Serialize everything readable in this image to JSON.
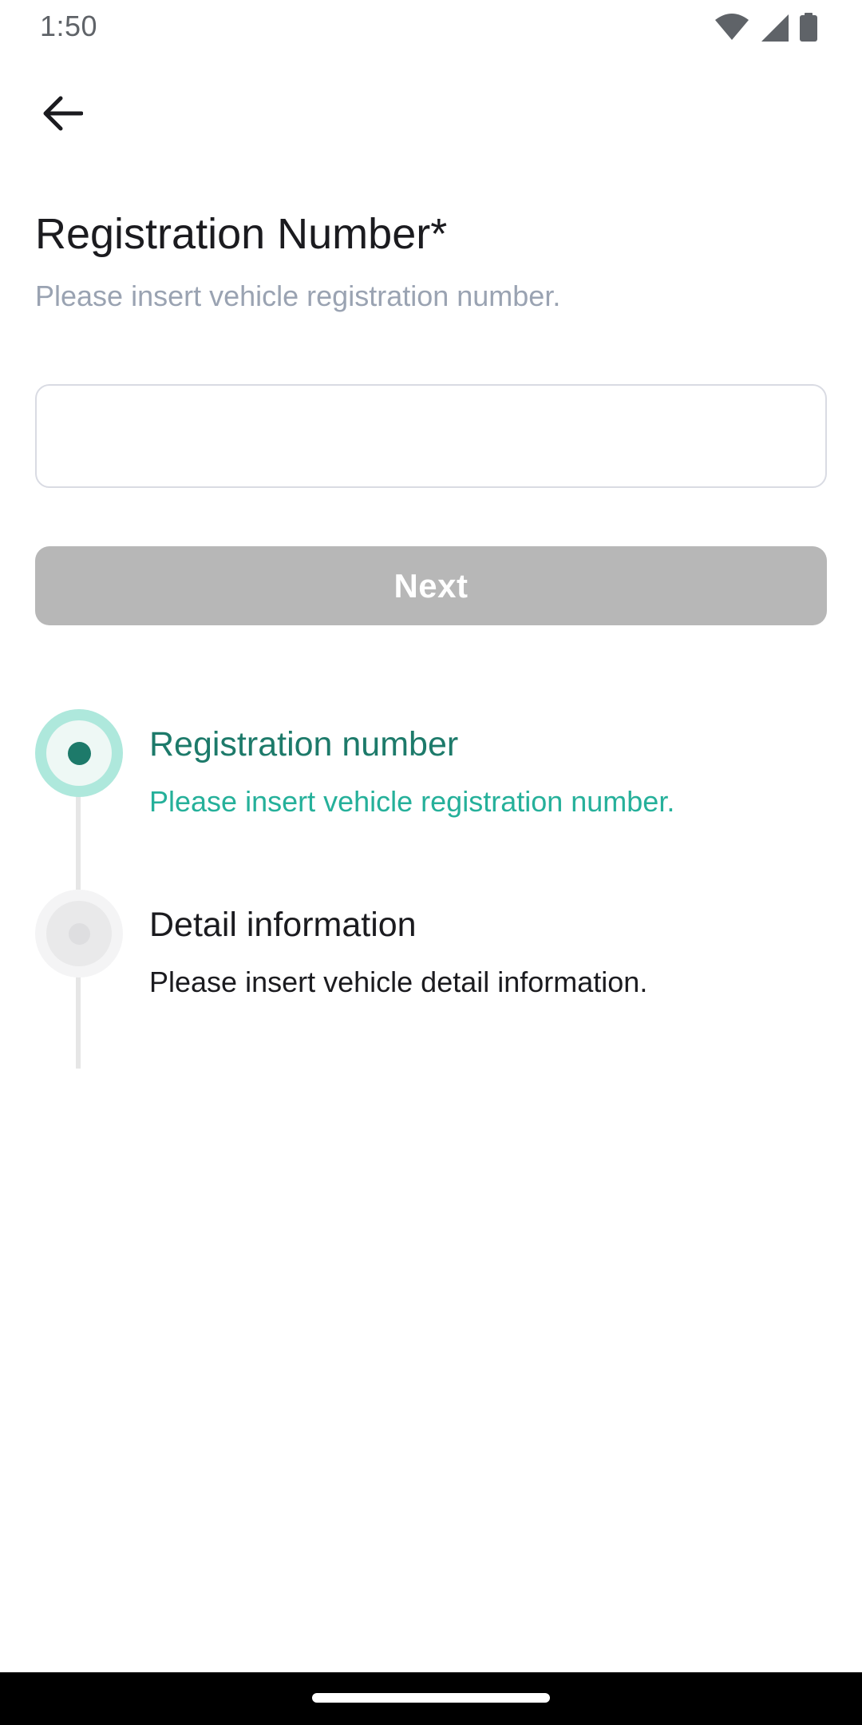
{
  "status_bar": {
    "time": "1:50",
    "icons": [
      "wifi-icon",
      "cellular-signal-icon",
      "battery-icon"
    ]
  },
  "navigation": {
    "back_icon": "arrow-left-icon"
  },
  "header": {
    "title": "Registration Number*",
    "subtitle": "Please insert vehicle registration number."
  },
  "form": {
    "registration_value": "",
    "registration_placeholder": ""
  },
  "actions": {
    "next_label": "Next",
    "next_enabled": false
  },
  "stepper": {
    "steps": [
      {
        "title": "Registration number",
        "description": "Please insert vehicle registration number.",
        "state": "active"
      },
      {
        "title": "Detail information",
        "description": "Please insert vehicle detail information.",
        "state": "inactive"
      }
    ]
  },
  "colors": {
    "accent_dark": "#1d7a6a",
    "accent_light": "#25b09a",
    "accent_ring": "#aee8dc",
    "button_disabled": "#b7b7b7",
    "subtitle_gray": "#9aa3b2"
  }
}
